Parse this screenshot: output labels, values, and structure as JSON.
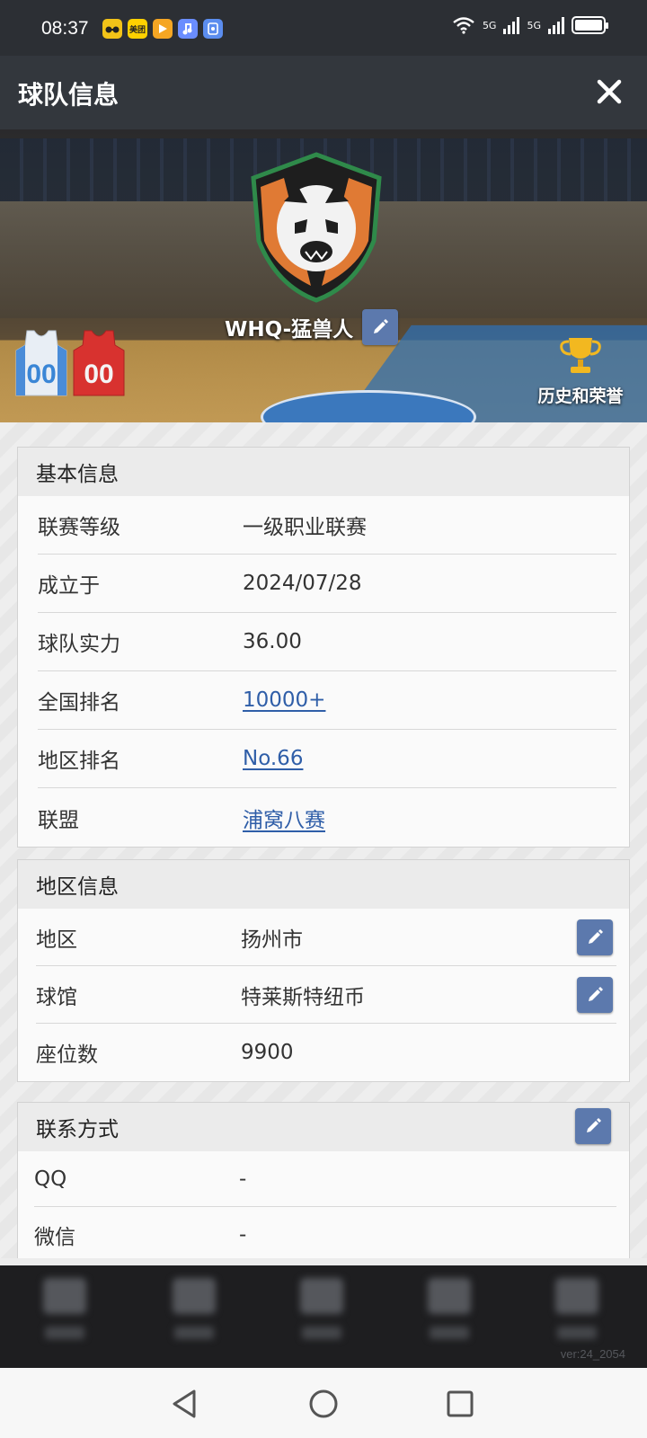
{
  "status_bar": {
    "time": "08:37",
    "app_icons": [
      {
        "name": "glasses-app-icon",
        "color": "#f2c318",
        "text": ""
      },
      {
        "name": "meituan-app-icon",
        "color": "#ffd100",
        "text": "美团"
      },
      {
        "name": "play-app-icon",
        "color": "#f5a623",
        "text": ""
      },
      {
        "name": "music-app-icon",
        "color": "#6a8dff",
        "text": ""
      },
      {
        "name": "wallet-app-icon",
        "color": "#5b8def",
        "text": ""
      }
    ],
    "network_1": "5G",
    "network_2": "5G"
  },
  "header": {
    "title": "球队信息"
  },
  "banner": {
    "team_name": "WHQ-猛兽人",
    "honor_label": "历史和荣誉",
    "home_jersey_number": "00",
    "away_jersey_number": "00"
  },
  "basic_info": {
    "title": "基本信息",
    "rows": [
      {
        "label": "联赛等级",
        "value": "一级职业联赛"
      },
      {
        "label": "成立于",
        "value": "2024/07/28"
      },
      {
        "label": "球队实力",
        "value": "36.00"
      },
      {
        "label": "全国排名",
        "value": "10000+"
      },
      {
        "label": "地区排名",
        "value": "No.66"
      },
      {
        "label": "联盟",
        "value": "浦窝八赛"
      }
    ]
  },
  "region_info": {
    "title": "地区信息",
    "rows": [
      {
        "label": "地区",
        "value": "扬州市"
      },
      {
        "label": "球馆",
        "value": "特莱斯特纽币"
      },
      {
        "label": "座位数",
        "value": "9900"
      }
    ]
  },
  "contact_info": {
    "title": "联系方式",
    "rows": [
      {
        "label": "QQ",
        "value": "-"
      },
      {
        "label": "微信",
        "value": "-"
      }
    ]
  },
  "bottom_nav": {
    "version": "ver:24_2054"
  },
  "colors": {
    "accent_link": "#2f5ea8",
    "edit_button": "#5c79ad",
    "header_bg": "#33373d"
  }
}
